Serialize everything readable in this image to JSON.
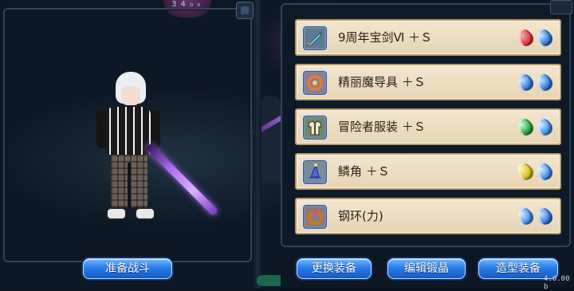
{
  "hud": {
    "top_counter": "3 4 ₀ ₀",
    "version": "4.0.00 b"
  },
  "buttons": {
    "prepare_battle": "准备战斗",
    "change_equipment": "更换装备",
    "edit_forge_crystal": "编辑锻晶",
    "style_equipment": "造型装备"
  },
  "equipment": {
    "slots": [
      {
        "name": "9周年宝剑Ⅵ ＋Ｓ",
        "icon": "sword-icon",
        "gems": [
          "#e0404a",
          "#3a82e0"
        ]
      },
      {
        "name": "精丽魔导具 ＋Ｓ",
        "icon": "magic-ring-icon",
        "gems": [
          "#3a82e0",
          "#3a82e0"
        ]
      },
      {
        "name": "冒险者服装 ＋Ｓ",
        "icon": "armor-icon",
        "gems": [
          "#2ea84a",
          "#4a96ec"
        ]
      },
      {
        "name": "鳞角 ＋Ｓ",
        "icon": "hat-icon",
        "gems": [
          "#d8c028",
          "#4a96ec"
        ]
      },
      {
        "name": "钢环(力)",
        "icon": "bracelet-icon",
        "gems": [
          "#4a96ec",
          "#3a82e0"
        ]
      }
    ]
  }
}
